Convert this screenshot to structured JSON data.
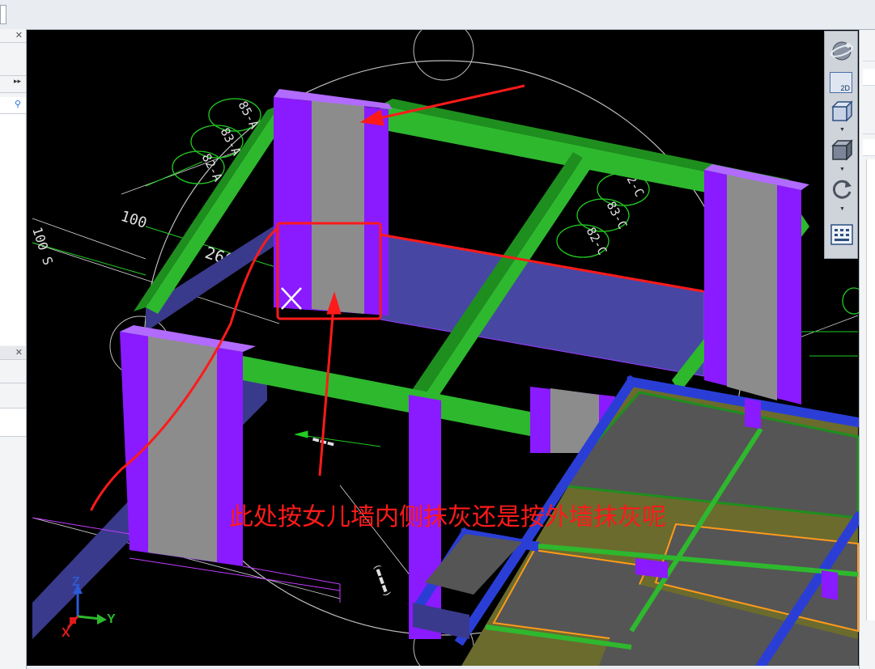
{
  "annotation": {
    "text": "此处按女儿墙内侧抹灰还是按外墙抹灰呢",
    "color": "#ff1a1a"
  },
  "cad_labels": {
    "axis_tags": [
      "85-A",
      "83-A",
      "82-A",
      "2-C",
      "83-C",
      "82-C"
    ],
    "dim_100": "100",
    "dim_2600": "2600",
    "dim_100s": "100 S"
  },
  "axes": {
    "x": "X",
    "y": "Y",
    "z": "Z"
  },
  "toolbar": {
    "view_2d_label": "2D"
  },
  "colors": {
    "viewport_bg": "#000000",
    "beam": "#2eb82e",
    "column": "#8a1aff",
    "column_core": "#8c8c8c",
    "wall": "#4040a0",
    "slab_edge": "#2a3ed6",
    "annotation_red": "#ff1a1a"
  },
  "icons": [
    "close-icon",
    "double-chevron-right-icon",
    "search-icon",
    "orbit-globe-icon",
    "view-2d-icon",
    "view-3d-box-icon",
    "view-solid-box-icon",
    "rotate-icon",
    "dashboard-icon"
  ]
}
